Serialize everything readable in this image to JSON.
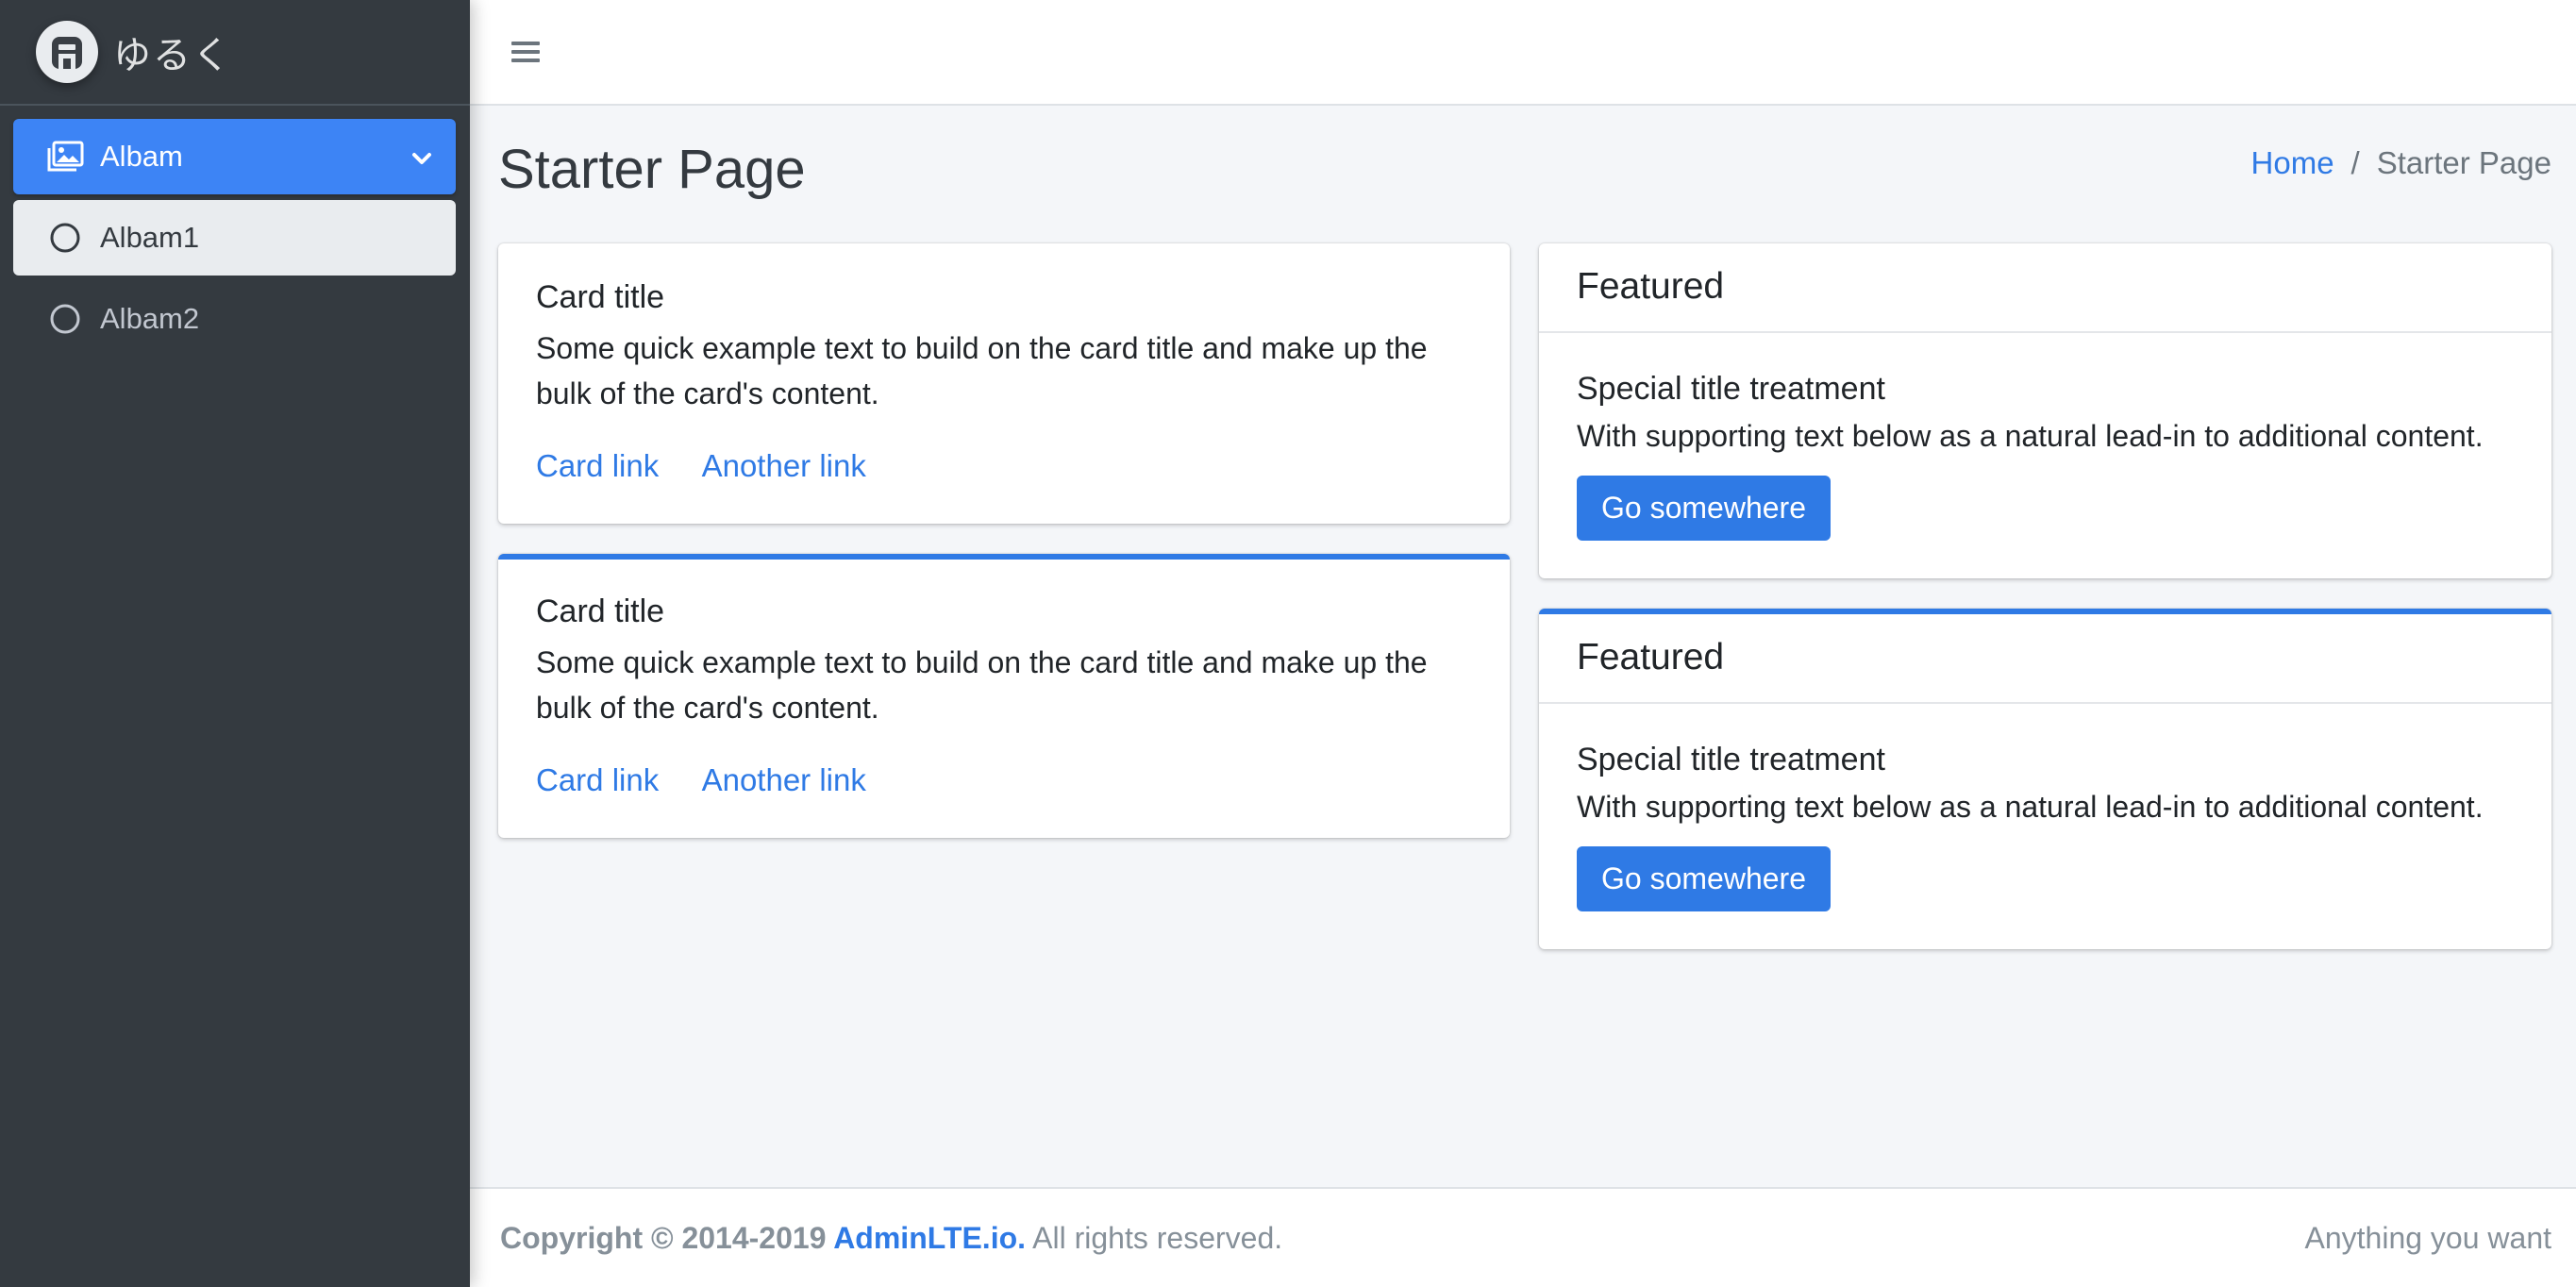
{
  "brand": {
    "text": "ゆるく",
    "logo_icon": "adminlte-logo-icon"
  },
  "sidebar": {
    "items": [
      {
        "label": "Albam",
        "icon": "images-icon",
        "expanded": true
      },
      {
        "label": "Albam1",
        "icon": "circle-icon",
        "selected": true
      },
      {
        "label": "Albam2",
        "icon": "circle-icon"
      }
    ]
  },
  "topbar": {
    "menu_icon": "hamburger-icon"
  },
  "page": {
    "title": "Starter Page",
    "breadcrumb": {
      "home": "Home",
      "separator": "/",
      "current": "Starter Page"
    }
  },
  "cards_left": [
    {
      "title": "Card title",
      "text": "Some quick example text to build on the card title and make up the bulk of the card's content.",
      "link1": "Card link",
      "link2": "Another link"
    },
    {
      "title": "Card title",
      "text": "Some quick example text to build on the card title and make up the bulk of the card's content.",
      "link1": "Card link",
      "link2": "Another link"
    }
  ],
  "cards_right": [
    {
      "header": "Featured",
      "title": "Special title treatment",
      "text": "With supporting text below as a natural lead-in to additional content.",
      "button": "Go somewhere"
    },
    {
      "header": "Featured",
      "title": "Special title treatment",
      "text": "With supporting text below as a natural lead-in to additional content.",
      "button": "Go somewhere"
    }
  ],
  "footer": {
    "copyright_prefix": "Copyright © 2014-2019 ",
    "copyright_link": "AdminLTE.io.",
    "copyright_suffix": " All rights reserved.",
    "right_text": "Anything you want"
  },
  "colors": {
    "primary": "#2f7ae5",
    "sidebar_bg": "#343a40",
    "content_bg": "#f4f6f9"
  }
}
